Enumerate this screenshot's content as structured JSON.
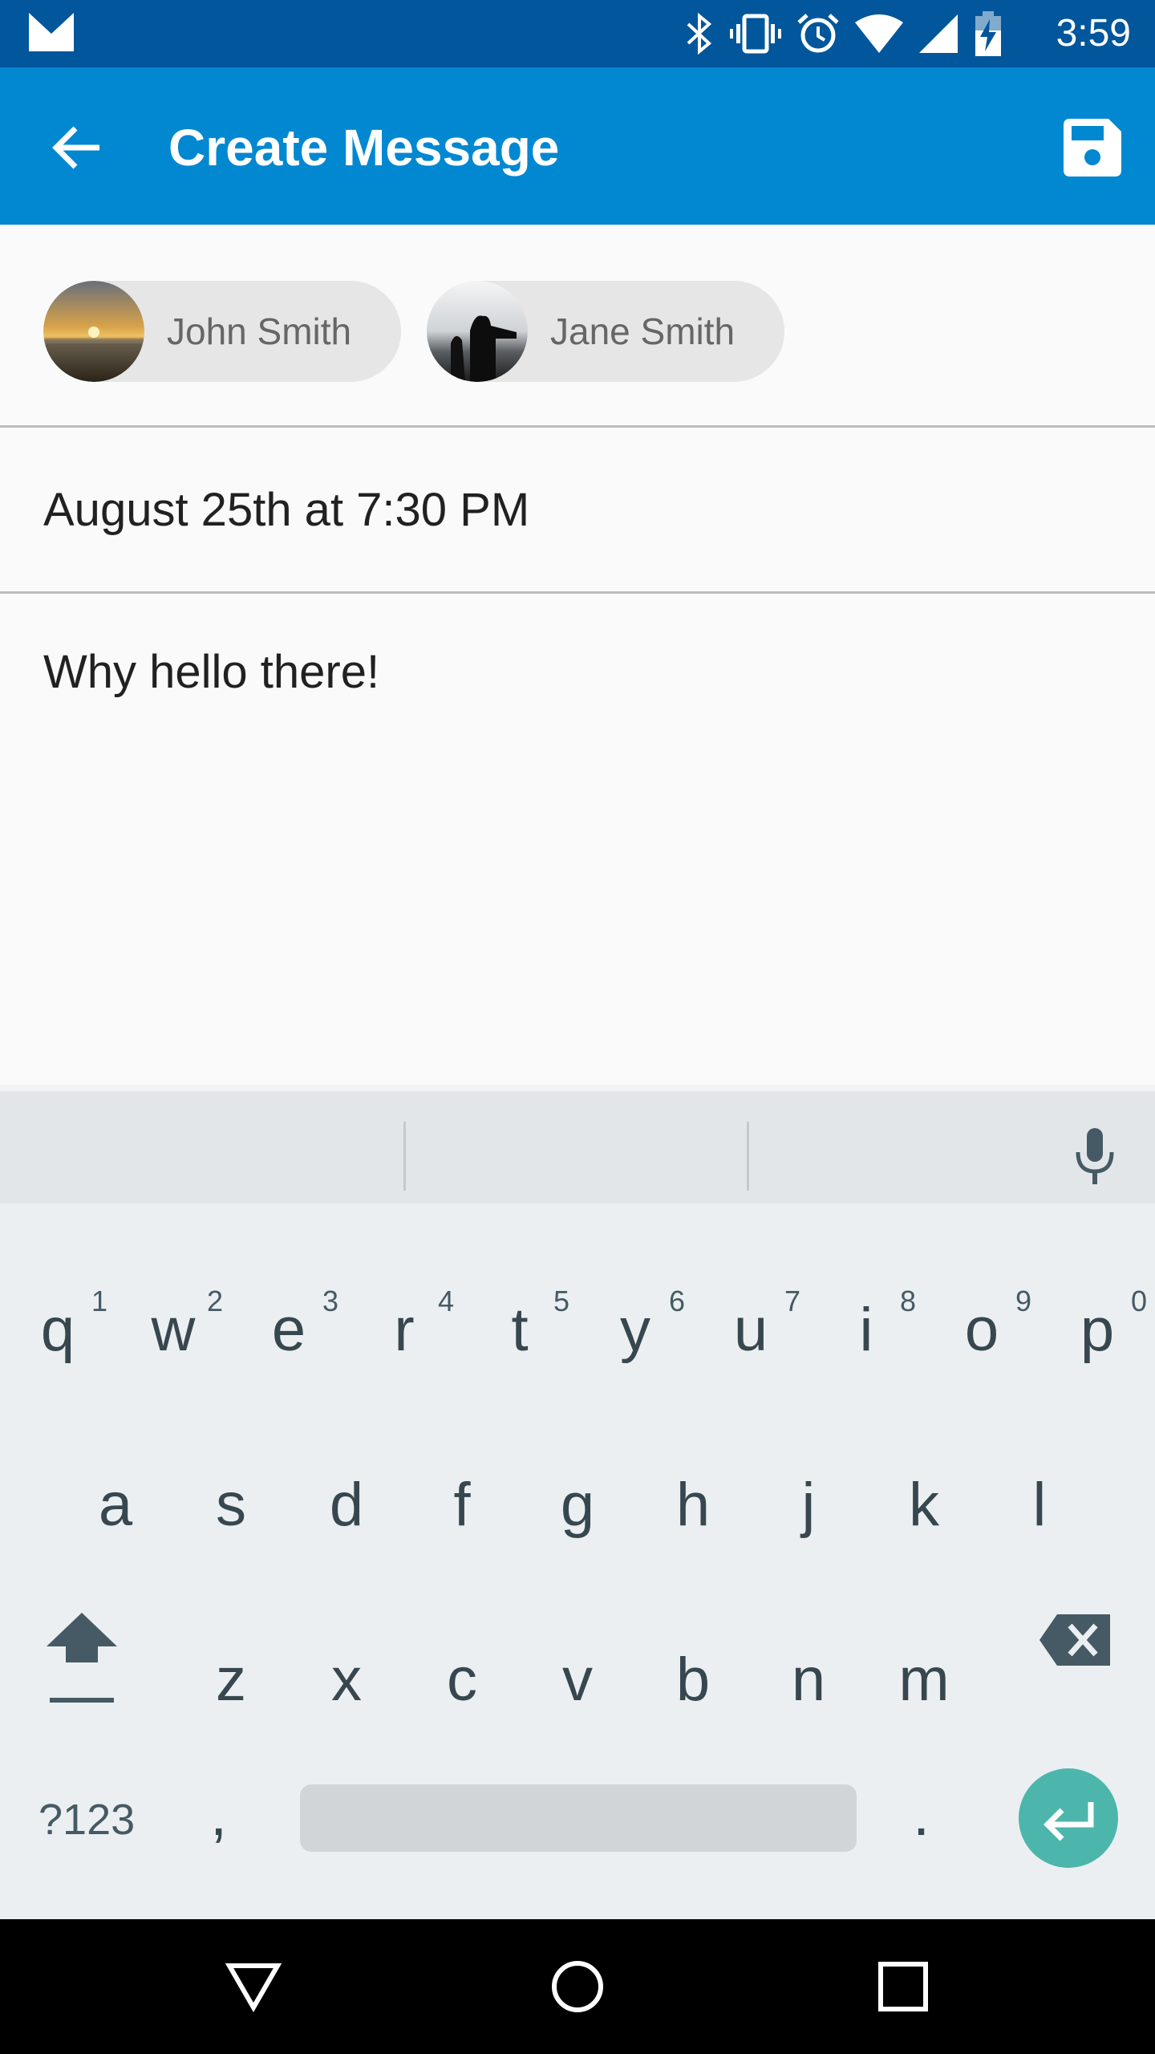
{
  "status_bar": {
    "time": "3:59",
    "icons": [
      "gmail-icon",
      "bluetooth-icon",
      "vibrate-icon",
      "alarm-icon",
      "wifi-icon",
      "signal-icon",
      "battery-charging-icon"
    ]
  },
  "app_bar": {
    "title": "Create Message",
    "back_icon": "arrow-back-icon",
    "save_icon": "save-icon"
  },
  "recipients": [
    {
      "name": "John Smith",
      "avatar": "sunset-photo"
    },
    {
      "name": "Jane Smith",
      "avatar": "people-silhouette-photo"
    }
  ],
  "schedule": {
    "value": "August 25th at 7:30 PM"
  },
  "message": {
    "value": "Why hello there!"
  },
  "keyboard": {
    "row1": [
      "q",
      "w",
      "e",
      "r",
      "t",
      "y",
      "u",
      "i",
      "o",
      "p"
    ],
    "row1_hints": [
      "1",
      "2",
      "3",
      "4",
      "5",
      "6",
      "7",
      "8",
      "9",
      "0"
    ],
    "row2": [
      "a",
      "s",
      "d",
      "f",
      "g",
      "h",
      "j",
      "k",
      "l"
    ],
    "row3": [
      "z",
      "x",
      "c",
      "v",
      "b",
      "n",
      "m"
    ],
    "symbols_label": "?123",
    "comma": ",",
    "period": ".",
    "accent_color": "#4db6ac"
  },
  "colors": {
    "status_bar": "#02569b",
    "app_bar": "#0288d1",
    "chip": "#e6e6e6"
  }
}
